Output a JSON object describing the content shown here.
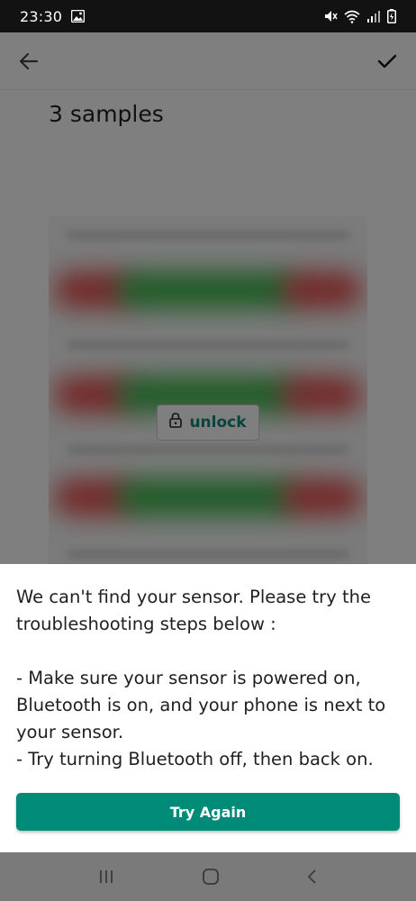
{
  "status_bar": {
    "time": "23:30",
    "icons": [
      "image-icon",
      "mute-vibrate-icon",
      "wifi-icon",
      "signal-icon",
      "battery-icon"
    ]
  },
  "app_bar": {
    "back_icon": "arrow-back-icon",
    "confirm_icon": "check-icon"
  },
  "page": {
    "title": "3 samples"
  },
  "locked_chart": {
    "unlock_label": "unlock",
    "unlock_icon": "lock-icon"
  },
  "dialog": {
    "message": "We can't find your sensor. Please try the troubleshooting steps below :\n\n- Make sure your sensor is powered on, Bluetooth is on, and your phone is next to your sensor.\n- Try turning Bluetooth off, then back on.",
    "button_label": "Try Again"
  },
  "nav_bar": {
    "icons": [
      "recent-apps-icon",
      "home-icon",
      "back-nav-icon"
    ]
  },
  "colors": {
    "accent": "#008a78",
    "unlock_text": "#0f8a79",
    "status_bar": "#121212",
    "nav_bar": "#7a7a7a"
  }
}
